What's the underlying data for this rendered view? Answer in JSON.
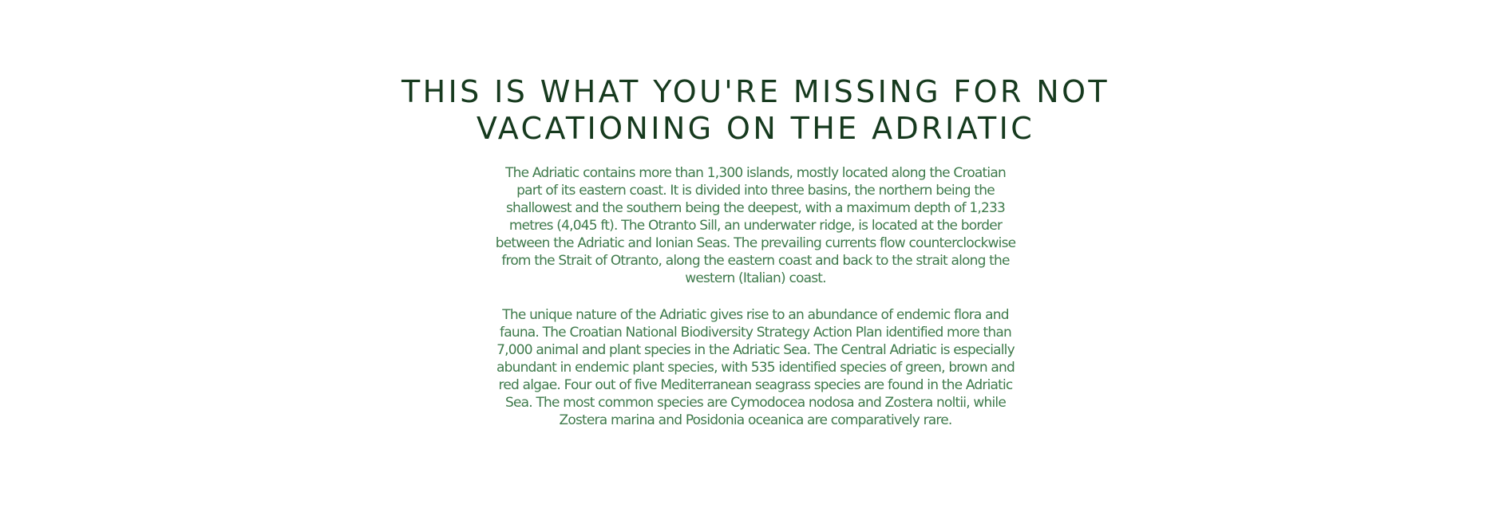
{
  "headline": {
    "line1": "THIS IS WHAT YOU'RE MISSING FOR NOT",
    "line2": "VACATIONING ON THE ADRIATIC"
  },
  "paragraphs": [
    "The Adriatic contains more than 1,300 islands, mostly located along the Croatian part of its eastern coast. It is divided into three basins, the northern being the shallowest and the southern being the deepest, with a maximum depth of 1,233 metres (4,045 ft). The Otranto Sill, an underwater ridge, is located at the border between the Adriatic and Ionian Seas. The prevailing currents flow counterclockwise from the Strait of Otranto, along the eastern coast and back to the strait along the western (Italian) coast.",
    "The unique nature of the Adriatic gives rise to an abundance of endemic flora and fauna. The Croatian National Biodiversity Strategy Action Plan identified more than 7,000 animal and plant species in the Adriatic Sea. The Central Adriatic is especially abundant in endemic plant species, with 535 identified species of green, brown and red algae. Four out of five Mediterranean seagrass species are found in the Adriatic Sea. The most common species are Cymodocea nodosa and Zostera noltii, while Zostera marina and Posidonia oceanica are comparatively rare."
  ],
  "colors": {
    "headline": "#163a1e",
    "body": "#3e7a4b",
    "background": "#ffffff"
  }
}
